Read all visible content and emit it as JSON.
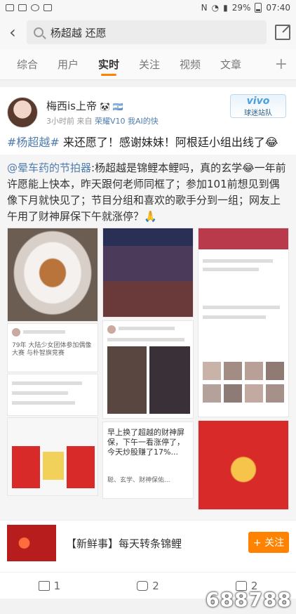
{
  "status": {
    "battery_percent": "29%",
    "time": "07:40"
  },
  "search": {
    "query": "杨超越 还愿"
  },
  "tabs": [
    {
      "label": "综合"
    },
    {
      "label": "用户"
    },
    {
      "label": "实时"
    },
    {
      "label": "关注"
    },
    {
      "label": "视频"
    },
    {
      "label": "文章"
    }
  ],
  "post": {
    "author": "梅西is上帝",
    "author_badges": "🐼 🇦🇷",
    "time_ago": "3小时前",
    "from_label": "来自",
    "device": "荣耀V10 我AI的快",
    "sponsor": {
      "brand": "vivo",
      "sub": "球迷站队"
    },
    "topic": "#杨超越#",
    "text": " 来还愿了！感谢妹妹！阿根廷小组出线了😂",
    "repost": {
      "mention": "@晕车药的节拍器",
      "text": ":杨超越是锦鲤本鲤吗，真的玄学😂一年前许愿能上快本，昨天跟何老师同框了；参加101前想见到偶像下月就快见了；节目分组和喜欢的歌手分到一组；网友上午用了财神屏保下午就涨停？🙏"
    },
    "grid_snippets": {
      "a2": "79年 大陆少女团体参加偶像大赛 与朴智旗竞赛",
      "b3": "早上换了超越的财神屏保，下午一看涨停了，今天炒股赚了17%...",
      "b3_sub": "聪、玄学、财神保佑..."
    },
    "news": {
      "text": "【新鲜事】每天转条锦鲤",
      "follow_label": "+ 关注"
    },
    "actions": {
      "reposts": "1",
      "comments": "2",
      "likes": "2"
    }
  },
  "watermark": "688788"
}
